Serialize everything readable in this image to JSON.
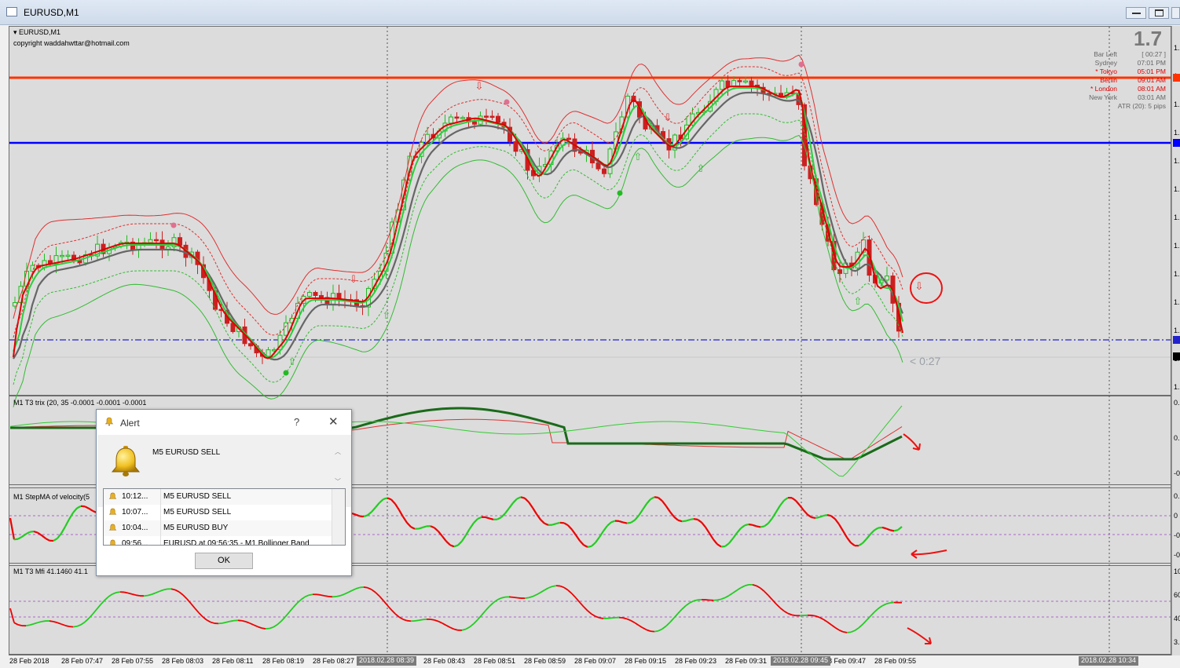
{
  "window": {
    "title": "EURUSD,M1"
  },
  "chart": {
    "symbol_label": "EURUSD,M1",
    "copyright": "copyright waddahwttar@hotmail.com",
    "big_value": "1.7",
    "countdown": "< 0:27",
    "bar_left_label": "Bar Left",
    "bar_left_value": "[ 00:27 ]",
    "sessions": [
      {
        "name": "Sydney",
        "time": "07:01 PM",
        "active": false
      },
      {
        "name": "* Tokyo",
        "time": "05:01 PM",
        "active": true
      },
      {
        "name": "Berlin",
        "time": "09:01 AM",
        "active": true
      },
      {
        "name": "* London",
        "time": "08:01 AM",
        "active": true
      },
      {
        "name": "New York",
        "time": "03:01 AM",
        "active": false
      }
    ],
    "atr_label": "ATR (20): 5 pips",
    "colors": {
      "bull": "#22bb22",
      "bear": "#cc2020",
      "upper_line": "#ff3300",
      "mid_line": "#0000ff",
      "dash_line": "#2222cc"
    }
  },
  "panes": [
    {
      "label": "M1 T3 trix (20, 35 -0.0001 -0.0001 -0.0001"
    },
    {
      "label": "M1 StepMA of velocity(5"
    },
    {
      "label": "M1  T3 Mfi  41.1460 41.1"
    }
  ],
  "time_axis": {
    "ticks": [
      "28 Feb 2018",
      "28 Feb 07:47",
      "28 Feb 07:55",
      "28 Feb 08:03",
      "28 Feb 08:11",
      "28 Feb 08:19",
      "28 Feb 08:27",
      "28 Feb 08:43",
      "28 Feb 08:51",
      "28 Feb 08:59",
      "28 Feb 09:07",
      "28 Feb 09:15",
      "28 Feb 09:23",
      "28 Feb 09:31",
      "28 Feb 09:47",
      "28 Feb 09:55"
    ],
    "highlighted": [
      "2018.02.28 08:39",
      "2018.02.28 09:45",
      "2018.02.28 10:34"
    ]
  },
  "right_scale": {
    "main": [
      "1.",
      "1.",
      "1.",
      "1.",
      "1.",
      "1.",
      "1.",
      "1.",
      "1.",
      "1.",
      "1.",
      "1.",
      "1."
    ],
    "trix": [
      "0.",
      "0.",
      "-0"
    ],
    "stepma": [
      "0.",
      "0",
      "-0",
      "-0"
    ],
    "mfi": [
      "10",
      "60",
      "40",
      "3."
    ]
  },
  "alert": {
    "title": "Alert",
    "help": "?",
    "message": "M5 EURUSD  SELL",
    "items": [
      {
        "time": "10:12...",
        "text": "M5 EURUSD  SELL"
      },
      {
        "time": "10:07...",
        "text": "M5 EURUSD  SELL"
      },
      {
        "time": "10:04...",
        "text": "M5 EURUSD  BUY"
      },
      {
        "time": "09:56...",
        "text": "EURUSD at 09:56:35 - M1 Bollinger Band"
      }
    ],
    "ok_label": "OK"
  }
}
